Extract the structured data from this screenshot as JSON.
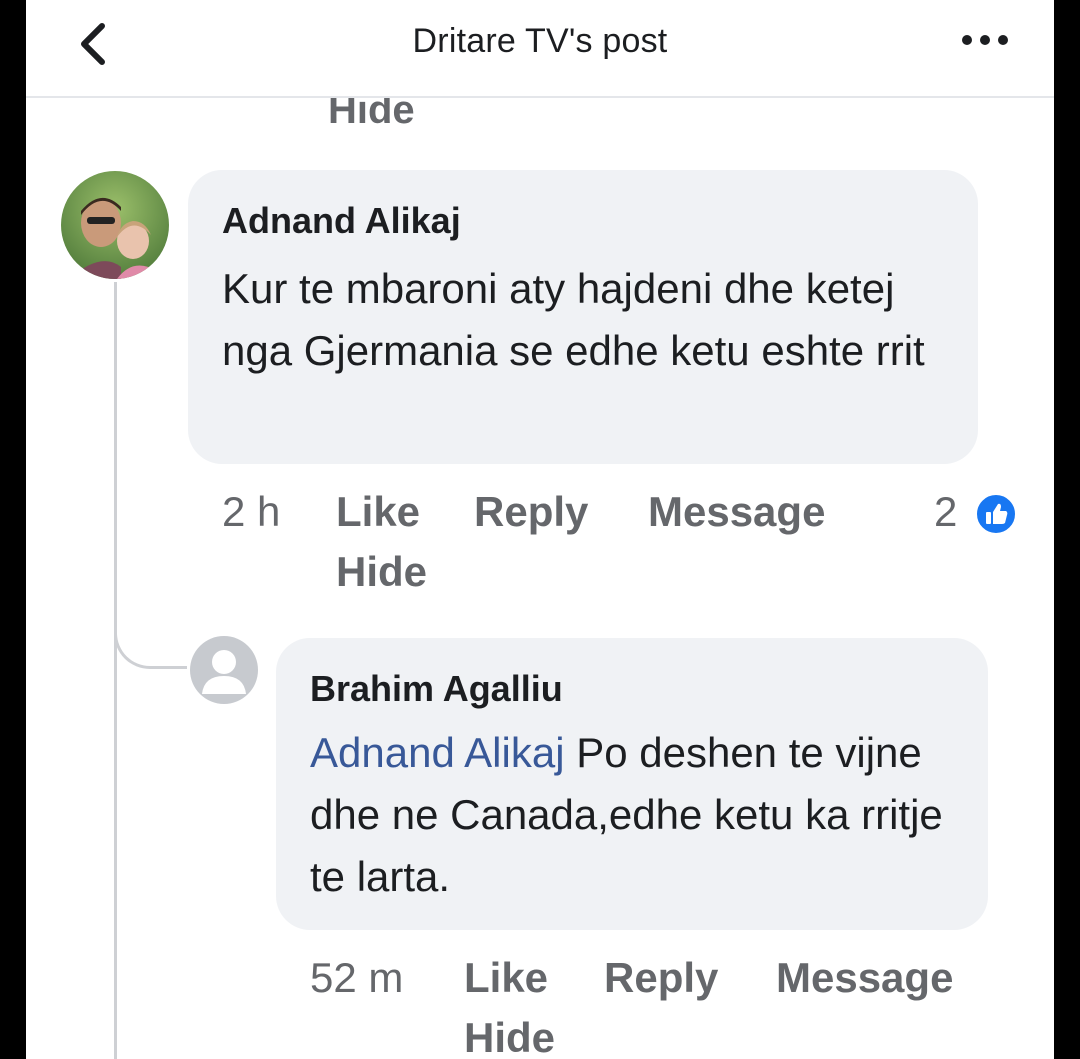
{
  "header": {
    "title": "Dritare TV's post",
    "back_icon": "chevron-left-icon",
    "more_icon": "more-dots-icon"
  },
  "previous_action": {
    "hide_label": "Hide"
  },
  "comments": [
    {
      "author": "Adnand Alikaj",
      "text": "Kur te mbaroni aty hajdeni dhe ketej nga Gjermania se edhe ketu eshte rrit",
      "time": "2 h",
      "like_label": "Like",
      "reply_label": "Reply",
      "message_label": "Message",
      "hide_label": "Hide",
      "reaction_count": "2",
      "reaction_icon": "thumbs-up-icon"
    }
  ],
  "replies": [
    {
      "author": "Brahim Agalliu",
      "mention": "Adnand Alikaj",
      "text": " Po deshen te vijne dhe ne Canada,edhe ketu ka rritje te larta.",
      "time": "52 m",
      "like_label": "Like",
      "reply_label": "Reply",
      "message_label": "Message",
      "hide_label": "Hide"
    }
  ],
  "colors": {
    "bubble": "#f0f2f5",
    "mention": "#385898",
    "secondary_text": "#65676b",
    "like_badge": "#1877f2"
  }
}
